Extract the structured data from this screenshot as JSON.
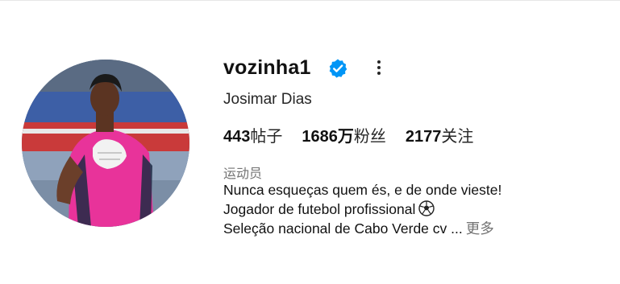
{
  "profile": {
    "username": "vozinha1",
    "full_name": "Josimar Dias",
    "verified": true,
    "stats": {
      "posts_value": "443",
      "posts_label": "帖子",
      "followers_value": "1686万",
      "followers_label": "粉丝",
      "following_value": "2177",
      "following_label": "关注"
    },
    "category": "运动员",
    "bio": {
      "line1": "Nunca esqueças quem és, e de onde vieste!",
      "line2": "Jogador de futebol profissional",
      "line3": "Seleção nacional de Cabo Verde cv ...",
      "more_label": "更多"
    }
  },
  "icons": {
    "verified": "verified-badge-icon",
    "options": "more-options-icon",
    "soccer": "soccer-ball-icon"
  },
  "colors": {
    "verified_blue": "#0095f6",
    "secondary_text": "#737373",
    "jersey_pink": "#e8339a"
  }
}
